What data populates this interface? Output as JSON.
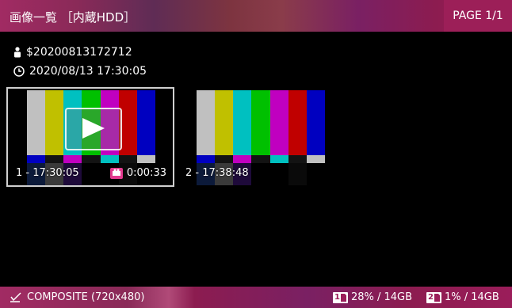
{
  "header": {
    "title": "画像一覧 ［内蔵HDD］",
    "page": "PAGE 1/1"
  },
  "info": {
    "user": "$20200813172712",
    "datetime": "2020/08/13 17:30:05"
  },
  "thumbnails": [
    {
      "label": "1 - 17:30:05",
      "duration": "0:00:33",
      "selected": true,
      "has_play": true
    },
    {
      "label": "2 - 17:38:48",
      "selected": false
    }
  ],
  "colors": {
    "accent": "#9c1f58",
    "bars": [
      "#c0c0c0",
      "#c0c000",
      "#00c0c0",
      "#00c000",
      "#c000c0",
      "#c00000",
      "#0000c0"
    ],
    "subbars": [
      "#0000c0",
      "#131313",
      "#c000c0",
      "#131313",
      "#00c0c0",
      "#131313",
      "#c0c0c0"
    ]
  },
  "footer": {
    "mode": "COMPOSITE (720x480)",
    "slot1": {
      "num": "1",
      "text": "28% / 14GB"
    },
    "slot2": {
      "num": "2",
      "text": "1% / 14GB"
    }
  }
}
